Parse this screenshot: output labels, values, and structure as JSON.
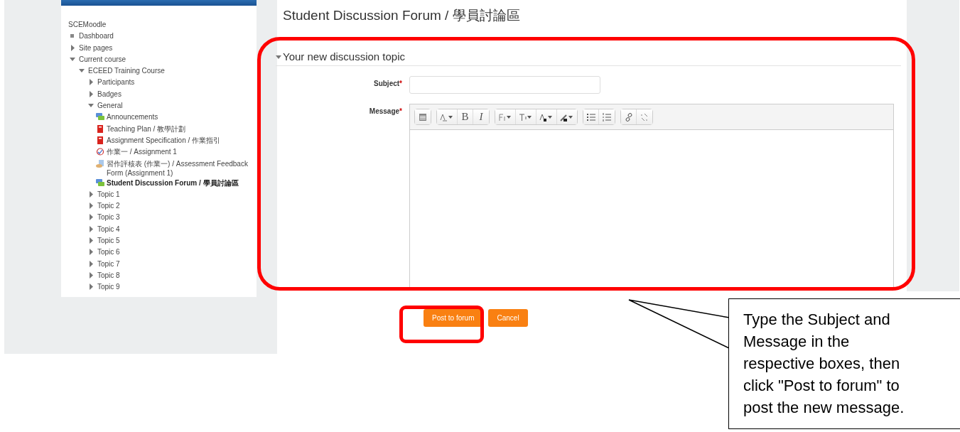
{
  "navigation": {
    "items": [
      {
        "label": "SCEMoodle",
        "kind": "root",
        "children": [
          {
            "label": "Dashboard",
            "kind": "leaf"
          },
          {
            "label": "Site pages",
            "kind": "branch",
            "expanded": false
          },
          {
            "label": "Current course",
            "kind": "branch",
            "expanded": true,
            "children": [
              {
                "label": "ECEED Training Course",
                "kind": "branch",
                "expanded": true,
                "children": [
                  {
                    "label": "Participants",
                    "kind": "branch",
                    "expanded": false
                  },
                  {
                    "label": "Badges",
                    "kind": "branch",
                    "expanded": false
                  },
                  {
                    "label": "General",
                    "kind": "branch",
                    "expanded": true,
                    "children": [
                      {
                        "label": "Announcements",
                        "kind": "forum",
                        "active": false
                      },
                      {
                        "label": "Teaching Plan / 教學計劃",
                        "kind": "file",
                        "active": false
                      },
                      {
                        "label": "Assignment Specification / 作業指引",
                        "kind": "file",
                        "active": false
                      },
                      {
                        "label": "作業一 / Assignment 1",
                        "kind": "assignment",
                        "active": false
                      },
                      {
                        "label": "習作評核表 (作業一) / Assessment Feedback Form (Assignment 1)",
                        "kind": "feedback",
                        "active": false
                      },
                      {
                        "label": "Student Discussion Forum / 學員討論區",
                        "kind": "forum",
                        "active": true
                      }
                    ]
                  },
                  {
                    "label": "Topic 1",
                    "kind": "branch",
                    "expanded": false
                  },
                  {
                    "label": "Topic 2",
                    "kind": "branch",
                    "expanded": false
                  },
                  {
                    "label": "Topic 3",
                    "kind": "branch",
                    "expanded": false
                  },
                  {
                    "label": "Topic 4",
                    "kind": "branch",
                    "expanded": false
                  },
                  {
                    "label": "Topic 5",
                    "kind": "branch",
                    "expanded": false
                  },
                  {
                    "label": "Topic 6",
                    "kind": "branch",
                    "expanded": false
                  },
                  {
                    "label": "Topic 7",
                    "kind": "branch",
                    "expanded": false
                  },
                  {
                    "label": "Topic 8",
                    "kind": "branch",
                    "expanded": false
                  },
                  {
                    "label": "Topic 9",
                    "kind": "branch",
                    "expanded": false
                  }
                ]
              }
            ]
          }
        ]
      }
    ]
  },
  "page_title": "Student Discussion Forum / 學員討論區",
  "section": {
    "title": "Your new discussion topic",
    "expanded": true
  },
  "form": {
    "subject_label": "Subject",
    "message_label": "Message",
    "required_mark": "*",
    "bold_key": "B",
    "italic_key": "I"
  },
  "buttons": [
    {
      "label": "Post to forum",
      "highlighted": true
    },
    {
      "label": "Cancel",
      "highlighted": false
    }
  ],
  "callout": "Type the Subject and Message in the respective boxes, then click \"Post to forum\" to post the new message."
}
